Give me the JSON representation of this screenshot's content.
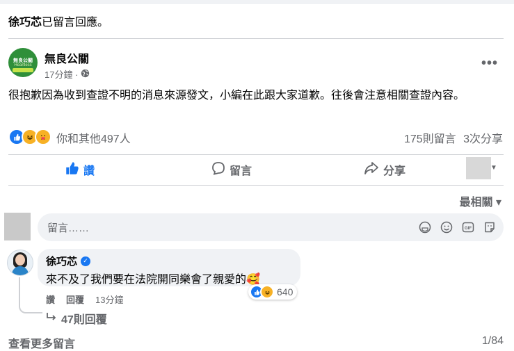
{
  "header": {
    "commenter": "徐巧芯",
    "action_text": "已留言回應。"
  },
  "post": {
    "page_name": "無良公關",
    "avatar_text": "無良公關",
    "avatar_subtext": "Heartless",
    "time": "17分鐘 ·",
    "privacy_icon": "globe-icon",
    "text": "很抱歉因為收到查證不明的消息來源發文，小編在此跟大家道歉。往後會注意相關查證內容。",
    "reactions_text": "你和其他497人",
    "comments_count": "175則留言",
    "shares_count": "3次分享"
  },
  "actions": {
    "like": "讚",
    "comment": "留言",
    "share": "分享"
  },
  "sort_label": "最相關 ▾",
  "comment_input": {
    "placeholder": "留言……"
  },
  "comment": {
    "author": "徐巧芯",
    "text": "來不及了我們要在法院開同樂會了親愛的🥰",
    "reaction_count": "640",
    "like_label": "讚",
    "reply_label": "回覆",
    "time": "13分鐘",
    "replies_label": "47則回覆"
  },
  "footer": {
    "more_comments": "查看更多留言",
    "pagination": "1/84"
  },
  "colors": {
    "accent": "#1877f2",
    "muted": "#65676b",
    "bubble": "#f0f2f5"
  }
}
